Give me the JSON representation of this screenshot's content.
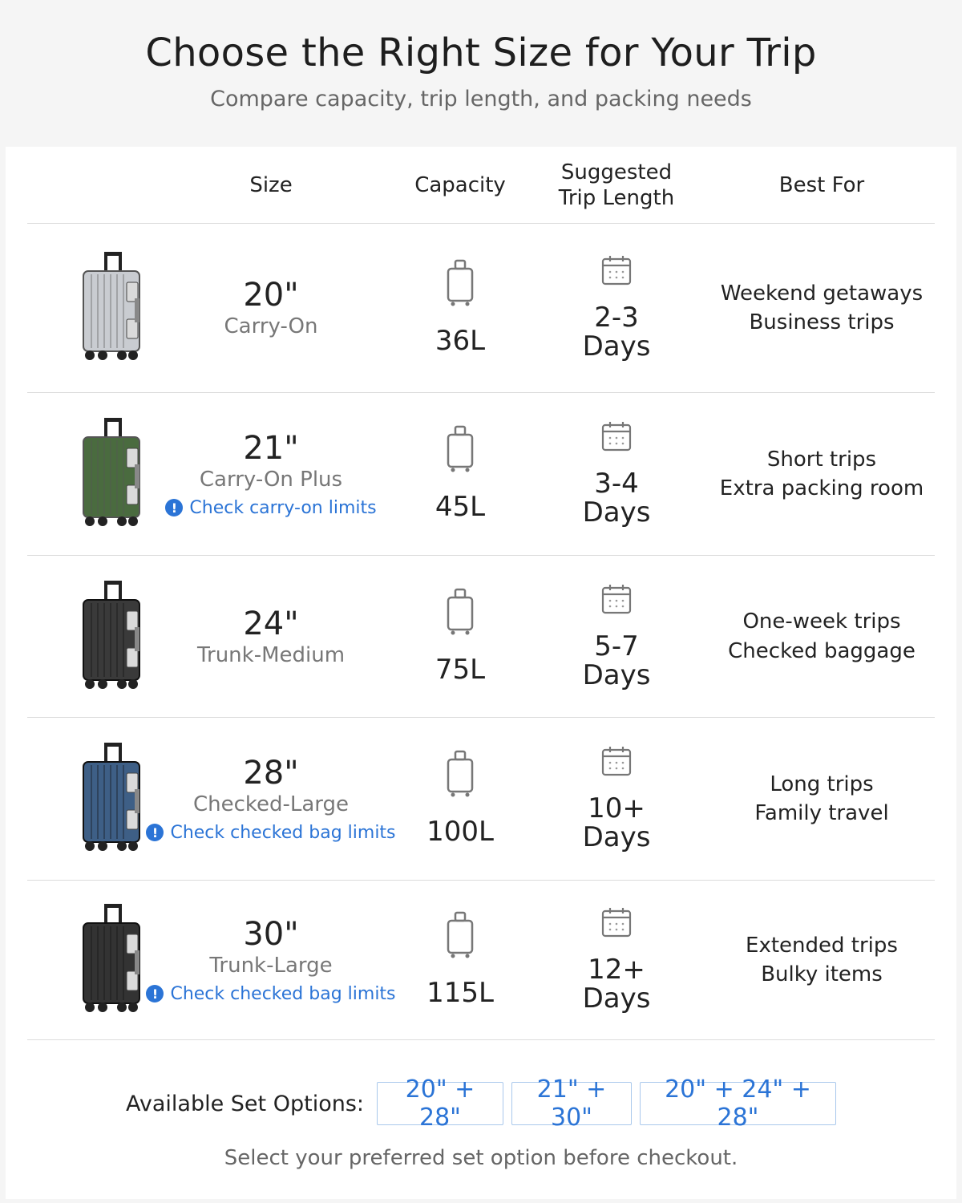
{
  "header": {
    "title": "Choose the Right Size for Your Trip",
    "subtitle": "Compare capacity, trip length, and packing needs"
  },
  "columns": {
    "size": "Size",
    "capacity": "Capacity",
    "trip_line1": "Suggested",
    "trip_line2": "Trip Length",
    "best_for": "Best For"
  },
  "rows": [
    {
      "size": "20\"",
      "name": "Carry-On",
      "limit": "",
      "capacity": "36L",
      "trip_range": "2-3",
      "trip_unit": "Days",
      "best1": "Weekend getaways",
      "best2": "Business trips",
      "color": "#c9ccd1",
      "icon": "silver-suitcase-icon"
    },
    {
      "size": "21\"",
      "name": "Carry-On Plus",
      "limit": "Check carry-on limits",
      "capacity": "45L",
      "trip_range": "3-4",
      "trip_unit": "Days",
      "best1": "Short trips",
      "best2": "Extra packing room",
      "color": "#4a6b3f",
      "icon": "green-suitcase-icon"
    },
    {
      "size": "24\"",
      "name": "Trunk-Medium",
      "limit": "",
      "capacity": "75L",
      "trip_range": "5-7",
      "trip_unit": "Days",
      "best1": "One-week trips",
      "best2": "Checked baggage",
      "color": "#3a3a3a",
      "icon": "black-suitcase-icon"
    },
    {
      "size": "28\"",
      "name": "Checked-Large",
      "limit": "Check checked bag limits",
      "capacity": "100L",
      "trip_range": "10+",
      "trip_unit": "Days",
      "best1": "Long trips",
      "best2": "Family travel",
      "color": "#3e5f86",
      "icon": "blue-suitcase-icon"
    },
    {
      "size": "30\"",
      "name": "Trunk-Large",
      "limit": "Check checked bag limits",
      "capacity": "115L",
      "trip_range": "12+",
      "trip_unit": "Days",
      "best1": "Extended trips",
      "best2": "Bulky items",
      "color": "#333333",
      "icon": "black-suitcase-icon"
    }
  ],
  "sets": {
    "label": "Available Set Options:",
    "options": [
      "20\" + 28\"",
      "21\" + 30\"",
      "20\" + 24\" + 28\""
    ]
  },
  "note": "Select your preferred set option before checkout.",
  "colors": {
    "link": "#2b74d6",
    "border": "#dcdcdc"
  }
}
